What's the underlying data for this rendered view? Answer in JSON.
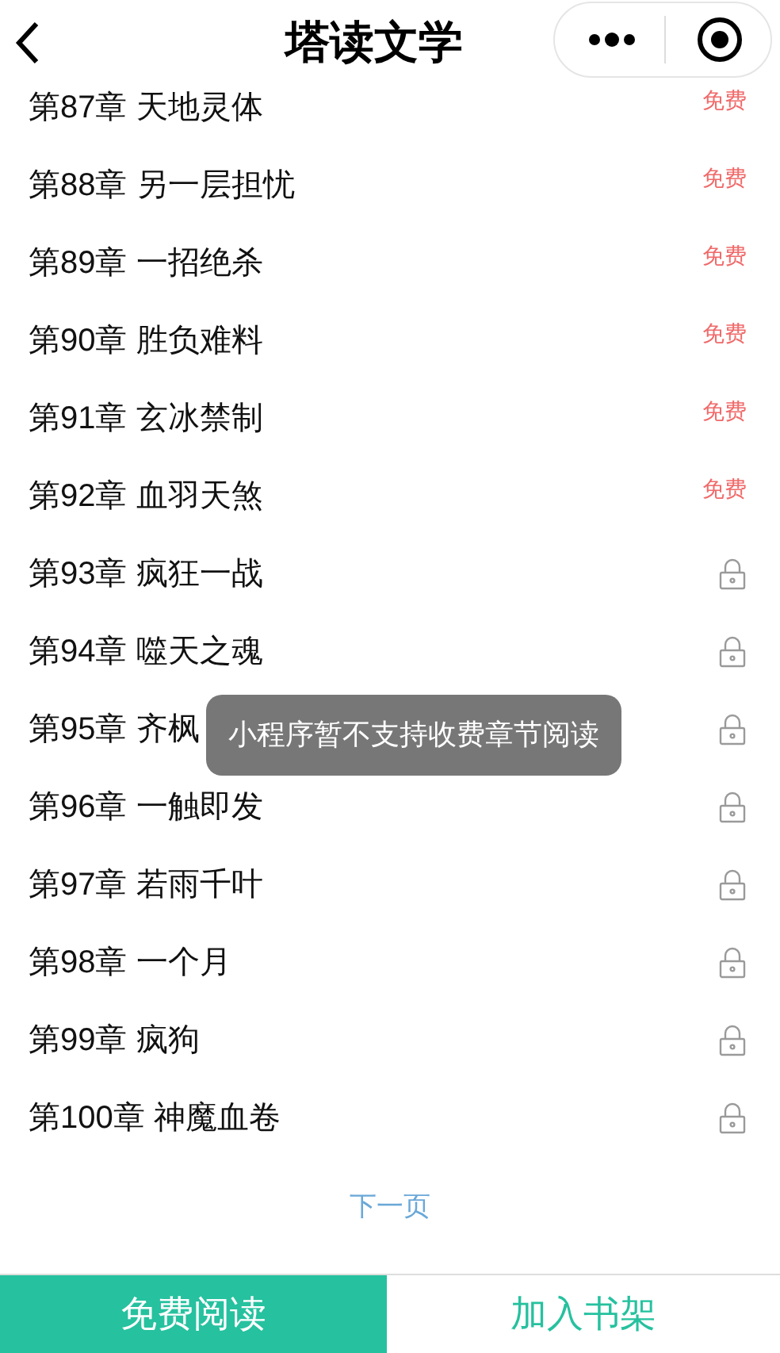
{
  "header": {
    "title": "塔读文学"
  },
  "chapters": [
    {
      "title": "第87章 天地灵体",
      "locked": false,
      "badge": "免费"
    },
    {
      "title": "第88章 另一层担忧",
      "locked": false,
      "badge": "免费"
    },
    {
      "title": "第89章 一招绝杀",
      "locked": false,
      "badge": "免费"
    },
    {
      "title": "第90章 胜负难料",
      "locked": false,
      "badge": "免费"
    },
    {
      "title": "第91章 玄冰禁制",
      "locked": false,
      "badge": "免费"
    },
    {
      "title": "第92章 血羽天煞",
      "locked": false,
      "badge": "免费"
    },
    {
      "title": "第93章 疯狂一战",
      "locked": true
    },
    {
      "title": "第94章 噬天之魂",
      "locked": true
    },
    {
      "title": "第95章 齐枫",
      "locked": true
    },
    {
      "title": "第96章 一触即发",
      "locked": true
    },
    {
      "title": "第97章 若雨千叶",
      "locked": true
    },
    {
      "title": "第98章 一个月",
      "locked": true
    },
    {
      "title": "第99章 疯狗",
      "locked": true
    },
    {
      "title": "第100章 神魔血卷",
      "locked": true
    }
  ],
  "next_page": "下一页",
  "toast": "小程序暂不支持收费章节阅读",
  "buttons": [
    {
      "label": "免费阅读",
      "kind": "primary"
    },
    {
      "label": "加入书架",
      "kind": "secondary"
    }
  ]
}
